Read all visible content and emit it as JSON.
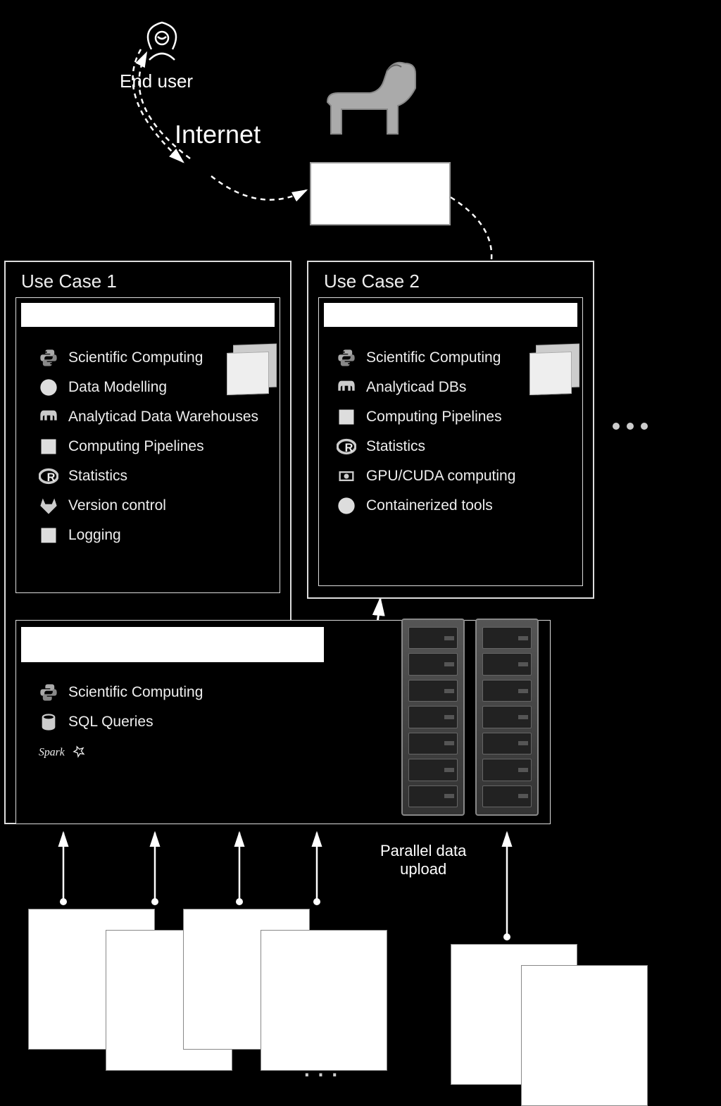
{
  "labels": {
    "end_user": "End user",
    "internet": "Internet",
    "parallel_upload": "Parallel data\nupload"
  },
  "uc1": {
    "title": "Use Case 1",
    "items": [
      {
        "icon": "python-icon",
        "label": "Scientific Computing"
      },
      {
        "icon": "circle-icon",
        "label": "Data Modelling"
      },
      {
        "icon": "elephant-icon",
        "label": "Analyticad Data Warehouses"
      },
      {
        "icon": "square-icon",
        "label": "Computing Pipelines"
      },
      {
        "icon": "r-icon",
        "label": "Statistics"
      },
      {
        "icon": "gitlab-icon",
        "label": "Version control"
      },
      {
        "icon": "square-icon",
        "label": "Logging"
      }
    ]
  },
  "uc2": {
    "title": "Use Case 2",
    "items": [
      {
        "icon": "python-icon",
        "label": "Scientific Computing"
      },
      {
        "icon": "elephant-icon",
        "label": "Analyticad DBs"
      },
      {
        "icon": "square-icon",
        "label": "Computing Pipelines"
      },
      {
        "icon": "r-icon",
        "label": "Statistics"
      },
      {
        "icon": "gpu-icon",
        "label": "GPU/CUDA computing"
      },
      {
        "icon": "circle-icon",
        "label": "Containerized tools"
      }
    ]
  },
  "lower": {
    "items": [
      {
        "icon": "python-icon",
        "label": "Scientific Computing"
      },
      {
        "icon": "sql-icon",
        "label": "SQL Queries"
      },
      {
        "icon": "spark-icon",
        "label": "Spark"
      }
    ]
  }
}
